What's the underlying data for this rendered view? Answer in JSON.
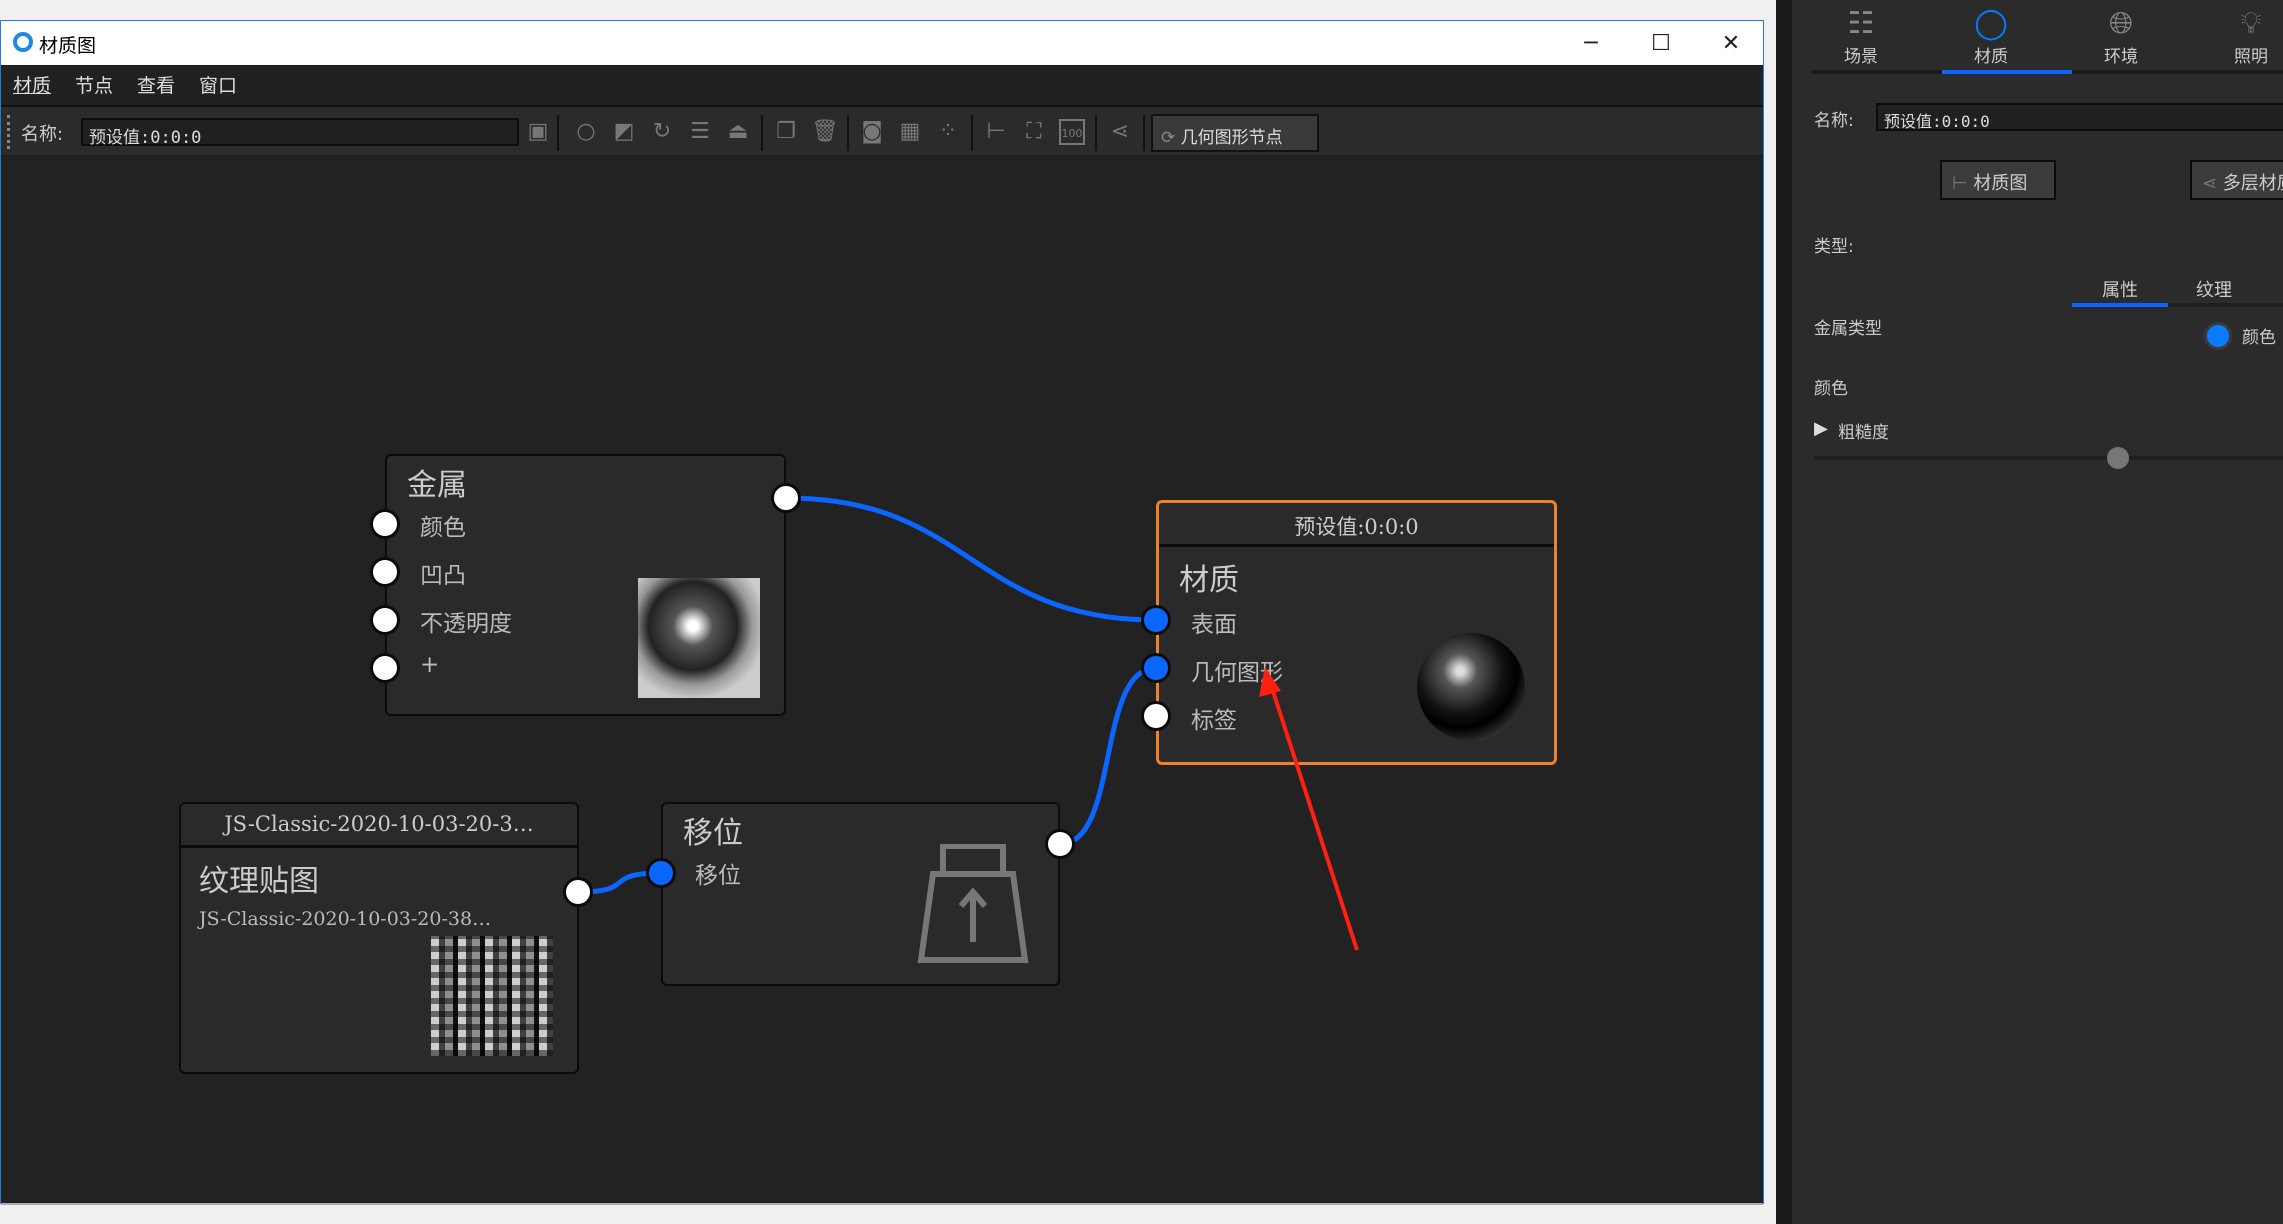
{
  "window": {
    "title": "材质图",
    "minimize": "─",
    "maximize": "☐",
    "close": "✕"
  },
  "menu": [
    "材质",
    "节点",
    "查看",
    "窗口"
  ],
  "toolbar": {
    "name_label": "名称:",
    "name_value": "预设值:0:0:0",
    "geometry_node_button": "几何图形节点",
    "icons": [
      "save-icon",
      "material-ball-icon",
      "checker-icon",
      "refresh-icon",
      "sliders-icon",
      "weight-icon",
      "copy-icon",
      "trash-icon",
      "add-node-icon",
      "grid-node-icon",
      "dots-node-icon",
      "layout-icon",
      "fit-view-icon",
      "zoom-100-icon",
      "share-icon"
    ],
    "zoom_100_text": "100"
  },
  "nodes": {
    "metal": {
      "title": "金属",
      "inputs": [
        "颜色",
        "凹凸",
        "不透明度",
        "+"
      ]
    },
    "material": {
      "header": "预设值:0:0:0",
      "title": "材质",
      "inputs": [
        "表面",
        "几何图形",
        "标签"
      ]
    },
    "texture": {
      "header": "JS-Classic-2020-10-03-20-3…",
      "title": "纹理贴图",
      "filename": "JS-Classic-2020-10-03-20-38…"
    },
    "displacement": {
      "title": "移位",
      "inputs": [
        "移位"
      ]
    }
  },
  "colors": {
    "accent": "#0a66ff",
    "selected_node": "#f0802a",
    "annotation_arrow": "#ff2010"
  },
  "panel": {
    "tabs": [
      {
        "label": "场景",
        "icon": "list-icon"
      },
      {
        "label": "材质",
        "icon": "material-icon",
        "active": true
      },
      {
        "label": "环境",
        "icon": "globe-icon"
      },
      {
        "label": "照明",
        "icon": "bulb-icon"
      }
    ],
    "name_label": "名称:",
    "name_value": "预设值:0:0:0",
    "material_graph_button": "材质图",
    "multilayer_button": "多层材质",
    "type_label": "类型:",
    "subtabs": [
      {
        "label": "属性",
        "active": true
      },
      {
        "label": "纹理"
      }
    ],
    "metal_type_label": "金属类型",
    "metal_type_option": "颜色",
    "color_label": "颜色",
    "roughness_label": "粗糙度",
    "roughness_value": 0.62
  }
}
